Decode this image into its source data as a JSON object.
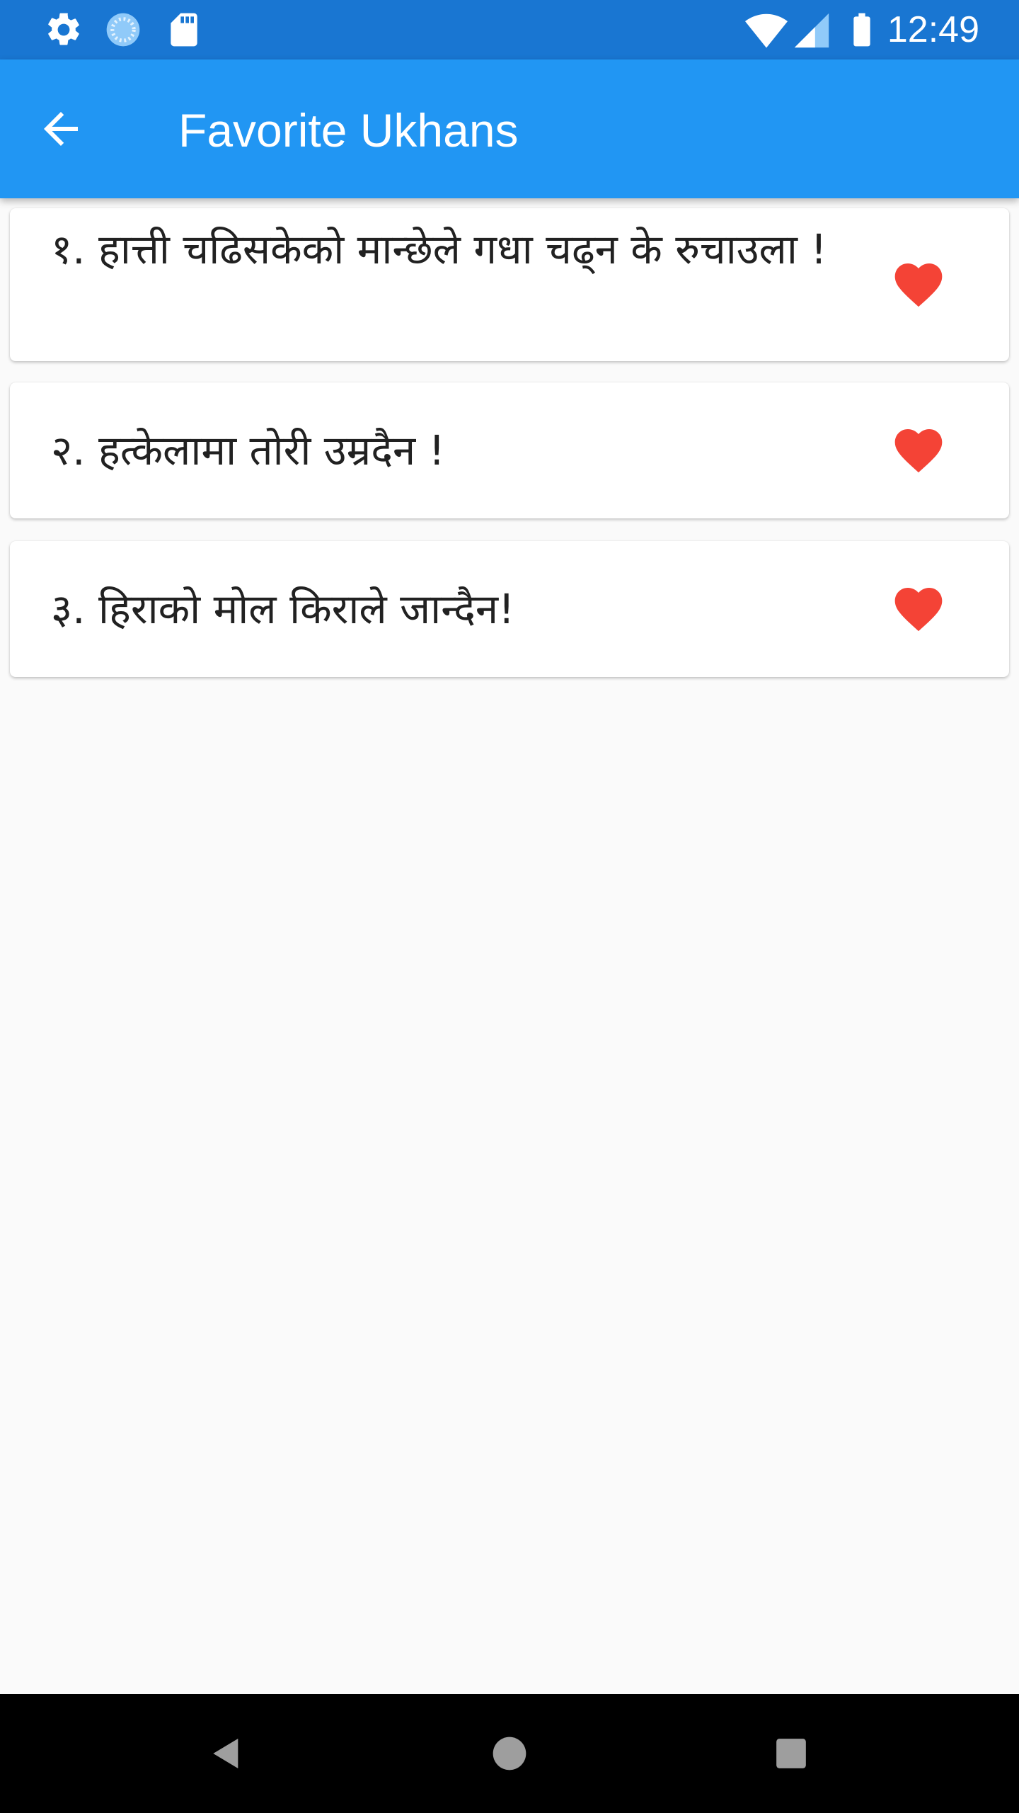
{
  "status_bar": {
    "time": "12:49",
    "left_icons": [
      "gear-icon",
      "sync-icon",
      "sd-card-icon"
    ],
    "right_icons": [
      "wifi-icon",
      "signal-icon",
      "battery-icon"
    ]
  },
  "app_bar": {
    "title": "Favorite Ukhans",
    "back_icon": "arrow-back-icon"
  },
  "favorites": [
    {
      "text": "१. हात्ती चढिसकेको मान्छेले गधा चढ्न के रुचाउला !",
      "favorited": true,
      "icon": "heart-icon"
    },
    {
      "text": "२. हत्केलामा तोरी उम्रदैन !",
      "favorited": true,
      "icon": "heart-icon"
    },
    {
      "text": "३. हिराको मोल किराले जान्दैन!",
      "favorited": true,
      "icon": "heart-icon"
    }
  ],
  "nav_bar": {
    "buttons": [
      "back-triangle-icon",
      "home-circle-icon",
      "recents-square-icon"
    ]
  },
  "colors": {
    "status_bar": "#1976d2",
    "app_bar": "#2196f3",
    "heart": "#f44336",
    "background": "#fafafa"
  }
}
